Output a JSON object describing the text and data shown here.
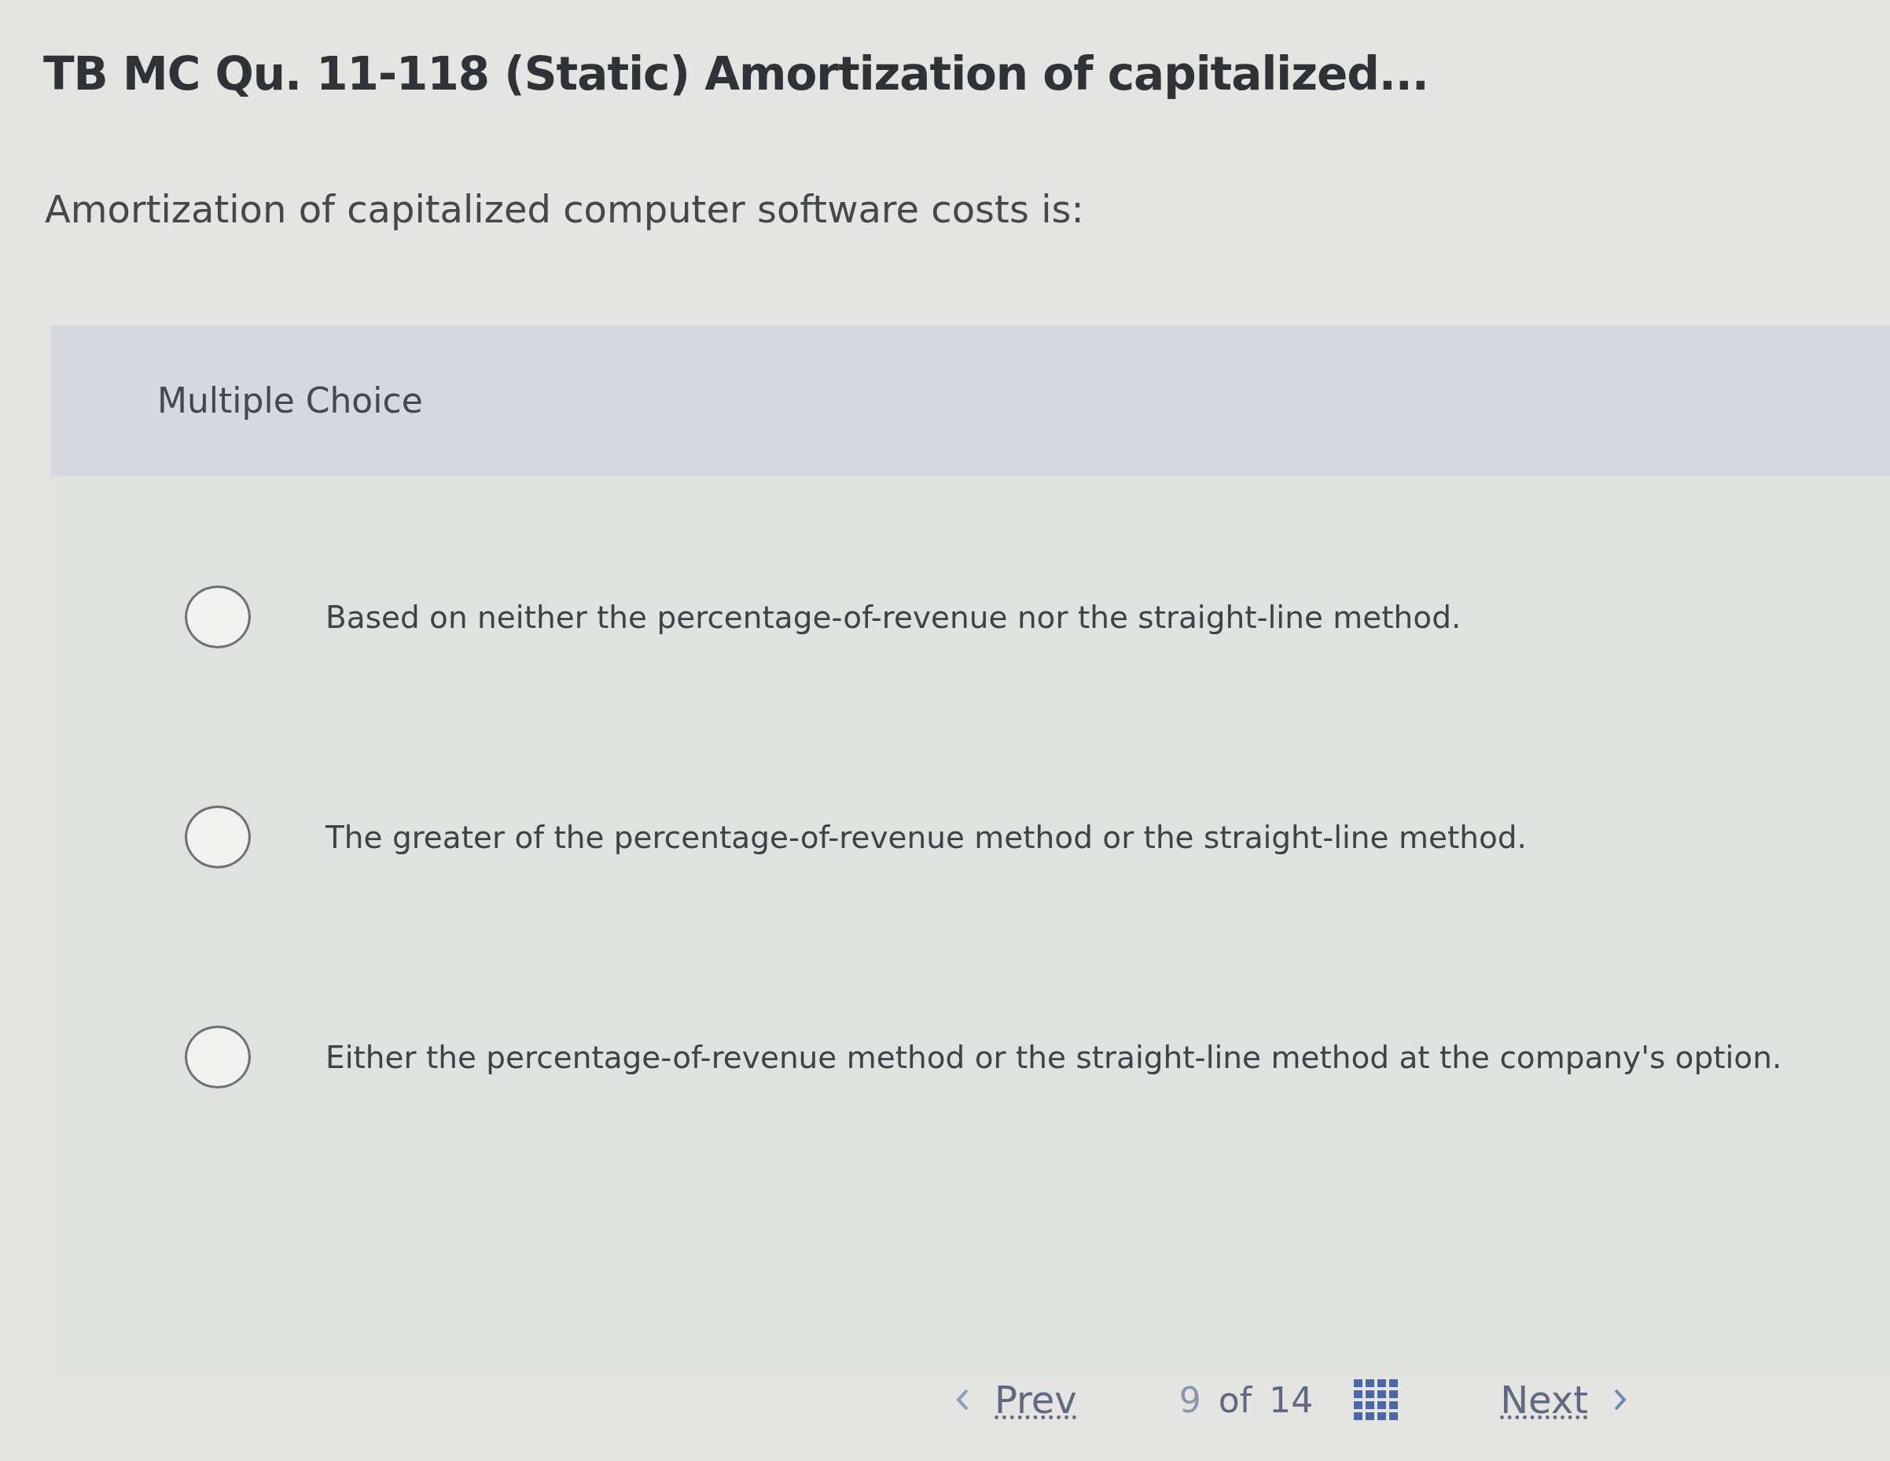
{
  "title": "TB MC Qu. 11-118 (Static) Amortization of capitalized...",
  "question": "Amortization of capitalized computer software costs is:",
  "answer_panel": {
    "label": "Multiple Choice",
    "options": [
      {
        "text": "Based on neither the percentage-of-revenue nor the straight-line method.",
        "selected": false
      },
      {
        "text": "The greater of the percentage-of-revenue method or the straight-line method.",
        "selected": false
      },
      {
        "text": "Either the percentage-of-revenue method or the straight-line method at the company's option.",
        "selected": false
      }
    ]
  },
  "navigation": {
    "prev": "Prev",
    "current": "9",
    "of": "of",
    "total": "14",
    "next": "Next"
  }
}
